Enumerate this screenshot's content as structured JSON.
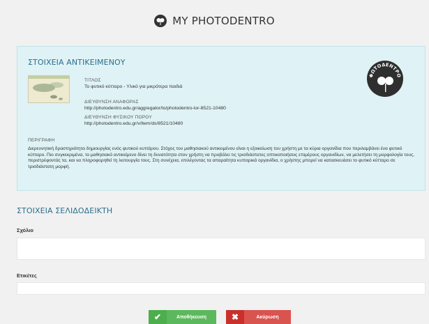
{
  "header": {
    "title": "MY PHOTODENTRO",
    "logo_icon": "photodentro-logo-icon"
  },
  "object_panel": {
    "title": "ΣΤΟΙΧΕΙΑ ΑΝΤΙΚΕΙΜΕΝΟΥ",
    "title_label": "ΤΙΤΛΟΣ",
    "title_value": "Το φυτικό κύτταρο - Υλικό για μικρότερα παιδιά",
    "ref_label": "ΔΙΕΥΘΥΝΣΗ ΑΝΑΦΟΡΑΣ",
    "ref_value": "http://photodentro.edu.gr/aggregator/lo/photodentro-lor-8521-10480",
    "phys_label": "ΔΙΕΥΘΥΝΣΗ ΦΥΣΙΚΟΥ ΠΟΡΟΥ",
    "phys_value": "http://photodentro.edu.gr/v/item/ds/8521/10480",
    "desc_label": "ΠΕΡΙΓΡΑΦΗ",
    "desc_value": "Διερευνητική δραστηριότητα δημιουργίας ενός φυτικού κυττάρου. Στόχος του μαθησιακού αντικειμένου είναι η εξοικείωση του χρήστη με τα κύρια οργανίδια που περιλαμβάνει ένα φυτικό κύτταρο. Πιο συγκεκριμένα, το μαθησιακό αντικείμενο δίνει τη δυνατότητα στον χρήστη να προβάλει τις τρισδιάστατες οπτικοποιήσεις επιμέρους οργανιδίων, να μελετήσει τη μορφολογία τους, περιστρέφοντάς τα, και να πληροφορηθεί τη λειτουργία τους. Στη συνέχεια, επιλέγοντας τα απαραίτητα κυτταρικά οργανίδια, ο χρήστης μπορεί να κατασκευάσει το φυτικό κύτταρο σε τρισδιάστατη μορφή.",
    "badge_text": "ΦΩΤΟΔΕΝΤΡΟ"
  },
  "bookmark": {
    "title": "ΣΤΟΙΧΕΙΑ ΣΕΛΙΔΟΔΕΙΚΤΗ",
    "comment_label": "Σχόλιο",
    "comment_value": "",
    "tags_label": "Ετικέτες",
    "tags_value": ""
  },
  "buttons": {
    "save_label": "Αποθήκευση",
    "cancel_label": "Ακύρωση"
  },
  "colors": {
    "panel_bg": "#dff2f5",
    "accent": "#2a6f8c",
    "save": "#5cb85c",
    "cancel": "#d9534f"
  }
}
